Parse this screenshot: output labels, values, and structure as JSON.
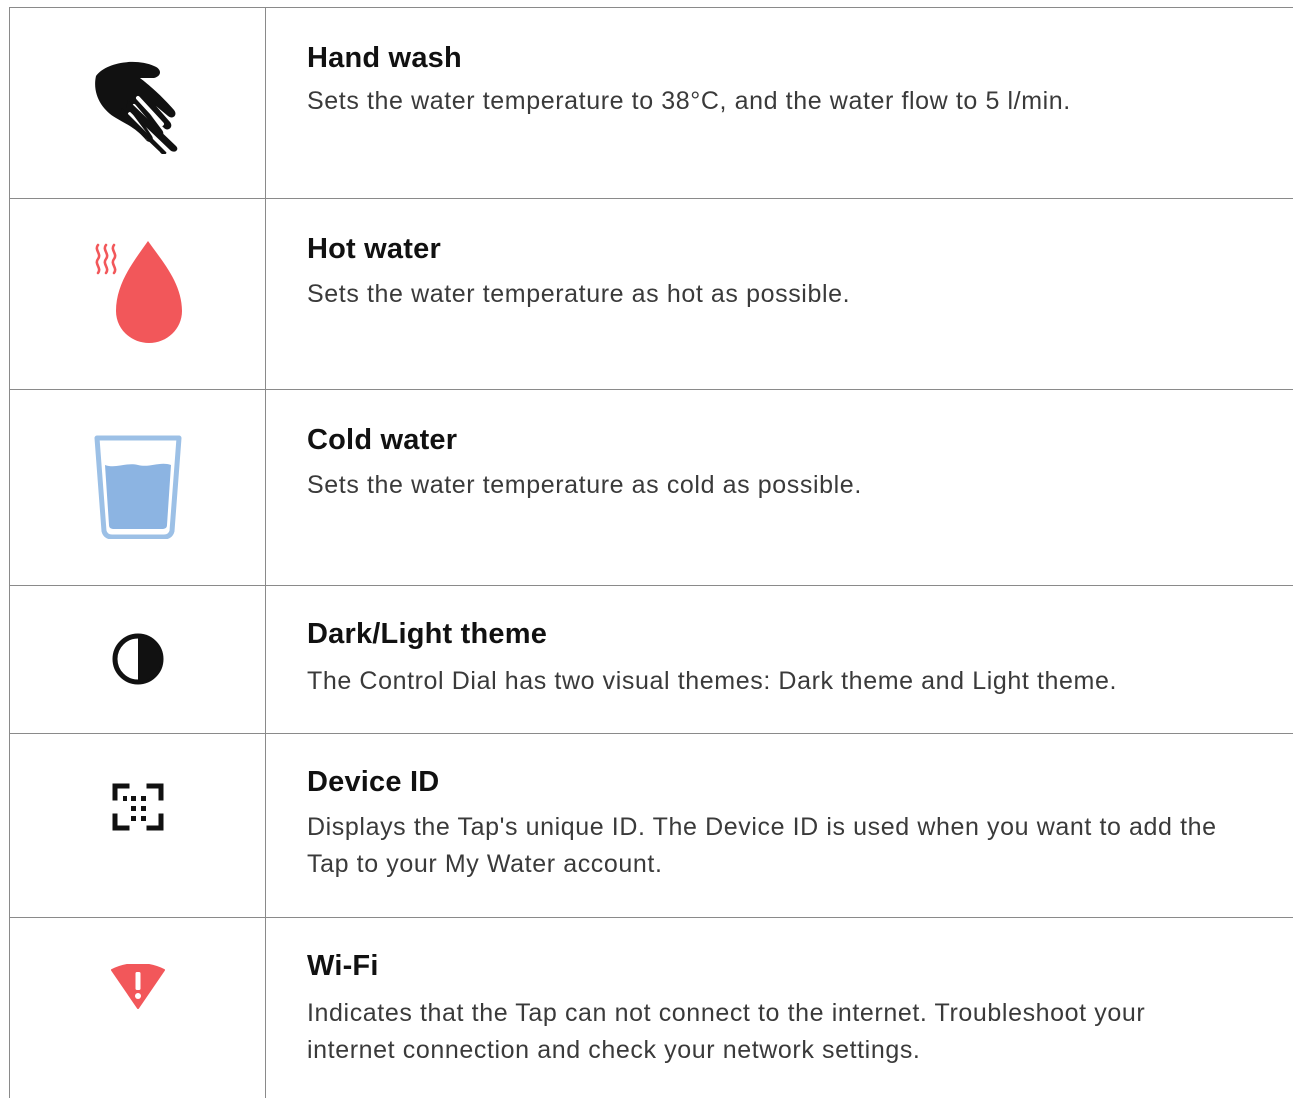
{
  "rows": [
    {
      "icon": "hand-wash-icon",
      "title": "Hand wash",
      "description": "Sets the water temperature to 38°C, and the water flow to 5 l/min."
    },
    {
      "icon": "hot-water-drop-icon",
      "title": "Hot water",
      "description": "Sets the water temperature as hot as possible."
    },
    {
      "icon": "cold-water-glass-icon",
      "title": "Cold water",
      "description": "Sets the water temperature as cold as possible."
    },
    {
      "icon": "theme-contrast-icon",
      "title": "Dark/Light theme",
      "description": "The Control Dial has two visual themes: Dark theme and Light theme."
    },
    {
      "icon": "device-id-icon",
      "title": "Device ID",
      "description": "Displays the Tap's unique ID. The Device ID is used when you want to add the Tap to your My Water account."
    },
    {
      "icon": "wifi-warning-icon",
      "title": "Wi-Fi",
      "description": "Indicates that the Tap can not connect to the internet. Troubleshoot your internet connection and check your network settings."
    }
  ],
  "colors": {
    "hot": "#f2575a",
    "cold": "#8cb4e2",
    "cold_outline": "#9cc0e6",
    "dark": "#111111",
    "warning": "#f2575a"
  }
}
